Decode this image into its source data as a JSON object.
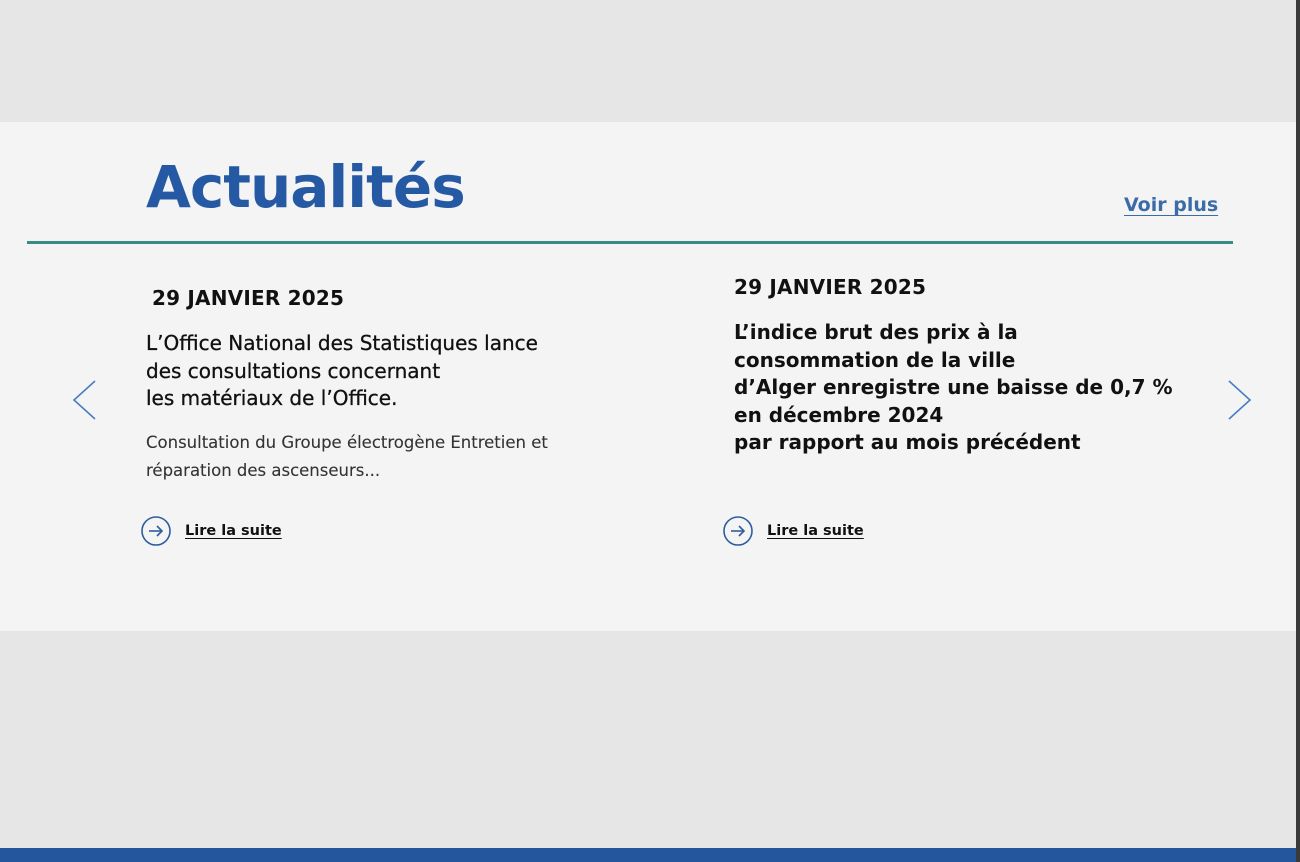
{
  "section": {
    "title": "Actualités",
    "see_more_label": "Voir plus"
  },
  "carousel": {
    "prev_icon": "chevron-left-icon",
    "next_icon": "chevron-right-icon"
  },
  "news": [
    {
      "date": "29 JANVIER 2025",
      "title_lines": [
        "L’Office National des Statistiques lance",
        "des consultations concernant",
        "les matériaux de l’Office."
      ],
      "excerpt_lines": [
        "Consultation du Groupe électrogène Entretien et",
        "réparation des ascenseurs..."
      ],
      "read_more_label": "Lire la suite"
    },
    {
      "date": "29 JANVIER 2025",
      "title_lines": [
        "L’indice brut des prix à la",
        "consommation de la ville",
        "d’Alger enregistre une baisse de 0,7 %",
        "en décembre 2024",
        "par rapport au mois précédent"
      ],
      "read_more_label": "Lire la suite"
    }
  ],
  "colors": {
    "title": "#2659a3",
    "divider": "#3a8d86",
    "footer": "#24569e",
    "page_background": "#e6e6e6",
    "section_background": "#f4f4f5"
  }
}
